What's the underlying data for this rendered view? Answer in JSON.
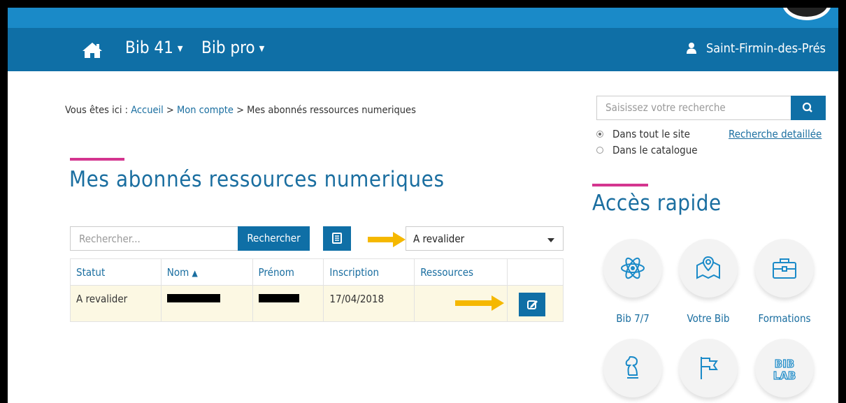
{
  "nav": {
    "menu1": "Bib 41",
    "menu2": "Bib pro",
    "user": "Saint-Firmin-des-Prés"
  },
  "breadcrumb": {
    "prefix": "Vous êtes ici : ",
    "home": "Accueil",
    "sep1": " > ",
    "account": "Mon compte",
    "sep2": " > ",
    "current": "Mes abonnés ressources numeriques"
  },
  "main": {
    "title": "Mes abonnés ressources numeriques",
    "search_placeholder": "Rechercher...",
    "search_button": "Rechercher",
    "filter_value": "A revalider",
    "columns": [
      "Statut",
      "Nom",
      "Prénom",
      "Inscription",
      "Ressources"
    ],
    "rows": [
      {
        "statut": "A revalider",
        "nom": "",
        "prenom": "",
        "inscription": "17/04/2018",
        "ressources": ""
      }
    ]
  },
  "sidebar": {
    "search_placeholder": "Saisissez votre recherche",
    "radio1": "Dans tout le site",
    "radio2": "Dans le catalogue",
    "advanced": "Recherche detaillée",
    "title": "Accès rapide",
    "tiles": [
      {
        "label": "Bib 7/7",
        "icon": "atom-icon"
      },
      {
        "label": "Votre Bib",
        "icon": "map-pin-icon"
      },
      {
        "label": "Formations",
        "icon": "briefcase-icon"
      },
      {
        "label": "",
        "icon": "chess-knight-icon"
      },
      {
        "label": "",
        "icon": "flag-icon"
      },
      {
        "label": "",
        "icon": "bib-lab-icon",
        "logo_text": "BIB LAB"
      }
    ]
  },
  "colors": {
    "nav_bg": "#0f6fa6",
    "accent": "#d4358f",
    "link": "#1a6ea0",
    "row_highlight": "#fcf8e3",
    "arrow": "#f5b800"
  }
}
